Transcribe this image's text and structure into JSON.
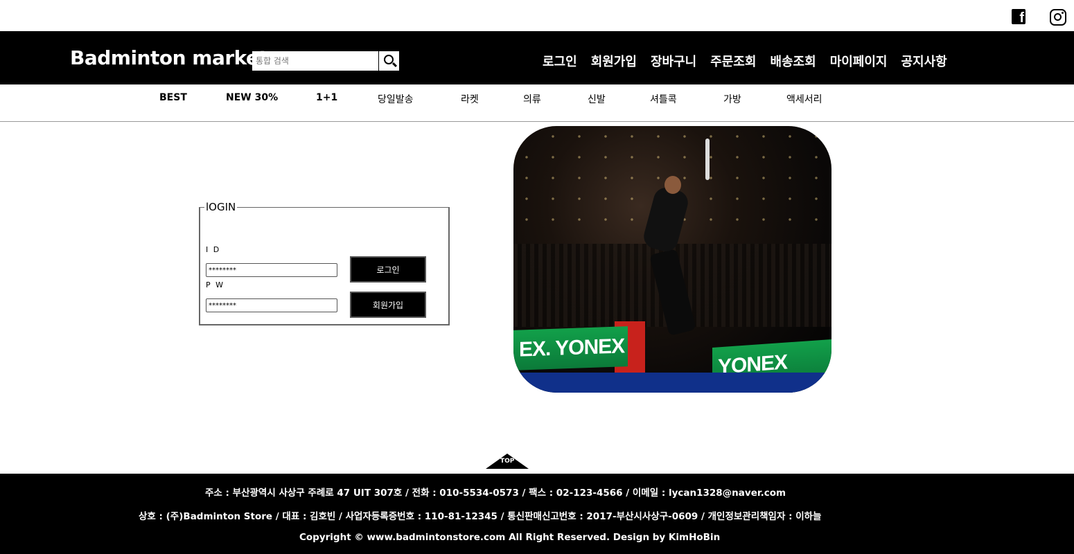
{
  "social": {
    "facebook_icon": "facebook-icon",
    "instagram_icon": "instagram-icon",
    "facebook_glyph": "f"
  },
  "header": {
    "logo": "Badminton market",
    "search_placeholder": "통합 검색",
    "nav": [
      "로그인",
      "회원가입",
      "장바구니",
      "주문조회",
      "배송조회",
      "마이페이지",
      "공지사항"
    ]
  },
  "categories": [
    "BEST",
    "NEW 30%",
    "1+1",
    "당일발송",
    "라켓",
    "의류",
    "신발",
    "셔틀콕",
    "가방",
    "액세서리"
  ],
  "login": {
    "legend": "lOGIN",
    "id_label": "I D",
    "pw_label": "P W",
    "id_value": "********",
    "pw_value": "********",
    "login_button": "로그인",
    "signup_button": "회원가입"
  },
  "hero": {
    "board_text_left": "EX. YONEX",
    "board_text_right": "YONEX"
  },
  "top_button": "TOP",
  "footer": {
    "line1": "주소 : 부산광역시 사상구 주례로 47 UIT 307호 / 전화 : 010-5534-0573 / 팩스 : 02-123-4566 / 이메일 : lycan1328@naver.com",
    "line2": "상호 : (주)Badminton Store / 대표 : 김호빈 / 사업자등록증번호 : 110-81-12345 / 통신판매신고번호 : 2017-부산시사상구-0609 / 개인정보관리책임자 : 이하늘",
    "line3": "Copyright © www.badmintonstore.com All Right Reserved. Design by KimHoBin"
  },
  "colors": {
    "header_bg": "#000000",
    "footer_bg": "#000000",
    "page_bg": "#ffffff",
    "board_green": "#12a04a"
  }
}
